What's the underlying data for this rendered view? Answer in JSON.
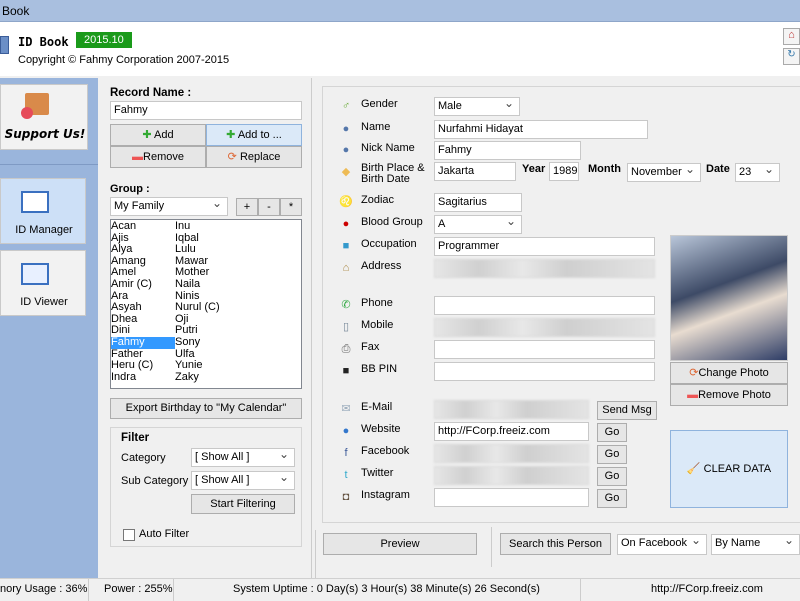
{
  "window": {
    "title": "Book"
  },
  "header": {
    "app_name": "ID Book",
    "version": "2015.10",
    "copyright": "Copyright © Fahmy Corporation 2007-2015"
  },
  "sidebar": {
    "support": "Support Us!",
    "items": [
      {
        "label": "ID Manager",
        "active": true
      },
      {
        "label": "ID Viewer",
        "active": false
      }
    ]
  },
  "left": {
    "record_label": "Record Name :",
    "record_value": "Fahmy",
    "buttons": {
      "add": "Add",
      "add_to": "Add to ...",
      "remove": "Remove",
      "replace": "Replace"
    },
    "group_label": "Group :",
    "group_value": "My Family",
    "group_btns": [
      "+",
      "-",
      "*"
    ],
    "names_col1": [
      "Acan",
      "Ajis",
      "Alya",
      "Amang",
      "Amel",
      "Amir (C)",
      "Ara",
      "Asyah",
      "Dhea",
      "Dini",
      "Fahmy",
      "Father",
      "Heru (C)",
      "Indra"
    ],
    "names_col2": [
      "Inu",
      "Iqbal",
      "Lulu",
      "Mawar",
      "Mother",
      "Naila",
      "Ninis",
      "Nurul (C)",
      "Oji",
      "Putri",
      "Sony",
      "Ulfa",
      "Yunie",
      "Zaky"
    ],
    "selected": "Fahmy",
    "export": "Export Birthday to \"My Calendar\"",
    "filter": {
      "title": "Filter",
      "category_label": "Category",
      "category_value": "[ Show All ]",
      "sub_label": "Sub Category",
      "sub_value": "[ Show All ]",
      "start": "Start Filtering",
      "auto": "Auto Filter",
      "auto_checked": false
    }
  },
  "form": {
    "gender": {
      "label": "Gender",
      "value": "Male"
    },
    "name": {
      "label": "Name",
      "value": "Nurfahmi Hidayat"
    },
    "nick": {
      "label": "Nick Name",
      "value": "Fahmy"
    },
    "birth": {
      "label1": "Birth Place &",
      "label2": "Birth Date",
      "place": "Jakarta",
      "year_label": "Year",
      "year": "1989",
      "month_label": "Month",
      "month": "November",
      "date_label": "Date",
      "date": "23"
    },
    "zodiac": {
      "label": "Zodiac",
      "value": "Sagitarius"
    },
    "blood": {
      "label": "Blood Group",
      "value": "A"
    },
    "occupation": {
      "label": "Occupation",
      "value": "Programmer"
    },
    "address": {
      "label": "Address"
    },
    "phone": {
      "label": "Phone",
      "value": ""
    },
    "mobile": {
      "label": "Mobile"
    },
    "fax": {
      "label": "Fax",
      "value": ""
    },
    "bbpin": {
      "label": "BB PIN",
      "value": ""
    },
    "email": {
      "label": "E-Mail",
      "button": "Send Msg"
    },
    "website": {
      "label": "Website",
      "value": "http://FCorp.freeiz.com",
      "button": "Go"
    },
    "facebook": {
      "label": "Facebook",
      "button": "Go"
    },
    "twitter": {
      "label": "Twitter",
      "button": "Go"
    },
    "instagram": {
      "label": "Instagram",
      "value": "",
      "button": "Go"
    },
    "photo": {
      "change": "Change Photo",
      "remove": "Remove Photo"
    },
    "clear": "CLEAR DATA"
  },
  "bottom": {
    "preview": "Preview",
    "search": "Search this Person",
    "search_on": "On Facebook",
    "search_by": "By Name"
  },
  "status": {
    "memory": "nory Usage : 36%",
    "power": "Power : 255%",
    "uptime": "System Uptime : 0 Day(s) 3 Hour(s) 38 Minute(s) 26 Second(s)",
    "url": "http://FCorp.freeiz.com"
  }
}
